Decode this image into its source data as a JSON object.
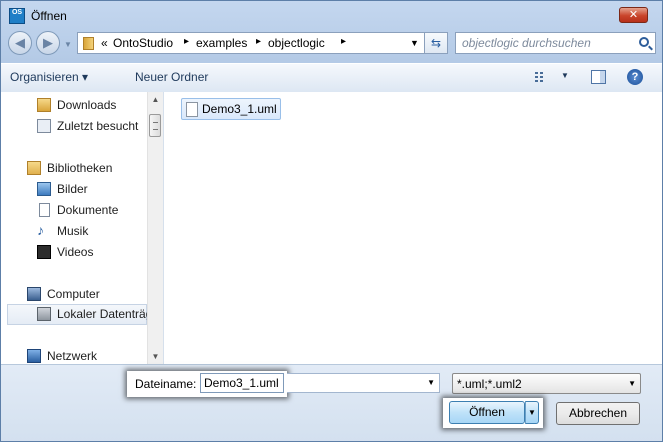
{
  "window": {
    "title": "Öffnen",
    "close_glyph": "✕",
    "app_icon_text": "OS"
  },
  "navigation": {
    "back_icon": "arrow-left-icon",
    "forward_icon": "arrow-right-icon",
    "breadcrumb": [
      "OntoStudio",
      "examples",
      "objectlogic"
    ],
    "breadcrumb_overflow": "«",
    "search_placeholder": "objectlogic durchsuchen"
  },
  "toolbar": {
    "organize_label": "Organisieren ▾",
    "new_folder_label": "Neuer Ordner",
    "view_icon": "view-options-icon",
    "preview_pane_icon": "preview-pane-icon",
    "help_icon": "help-icon"
  },
  "sidebar": {
    "items": [
      {
        "label": "Downloads",
        "icon": "downloads-folder-icon"
      },
      {
        "label": "Zuletzt besucht",
        "icon": "recent-places-icon"
      },
      {
        "label": "Bibliotheken",
        "icon": "libraries-icon"
      },
      {
        "label": "Bilder",
        "icon": "pictures-icon"
      },
      {
        "label": "Dokumente",
        "icon": "documents-icon"
      },
      {
        "label": "Musik",
        "icon": "music-icon"
      },
      {
        "label": "Videos",
        "icon": "videos-icon"
      },
      {
        "label": "Computer",
        "icon": "computer-icon"
      },
      {
        "label": "Lokaler Datenträger",
        "icon": "local-disk-icon",
        "selected": true
      },
      {
        "label": "Netzwerk",
        "icon": "network-icon"
      }
    ]
  },
  "files": [
    {
      "name": "Demo3_1.uml",
      "selected": true
    }
  ],
  "bottom": {
    "filename_label": "Dateiname:",
    "filename_value": "Demo3_1.uml",
    "filter_value": "*.uml;*.uml2",
    "open_label": "Öffnen",
    "cancel_label": "Abbrechen"
  },
  "colors": {
    "accent": "#3c7fb1",
    "selection": "#d9e8fb",
    "close": "#c9442b"
  }
}
